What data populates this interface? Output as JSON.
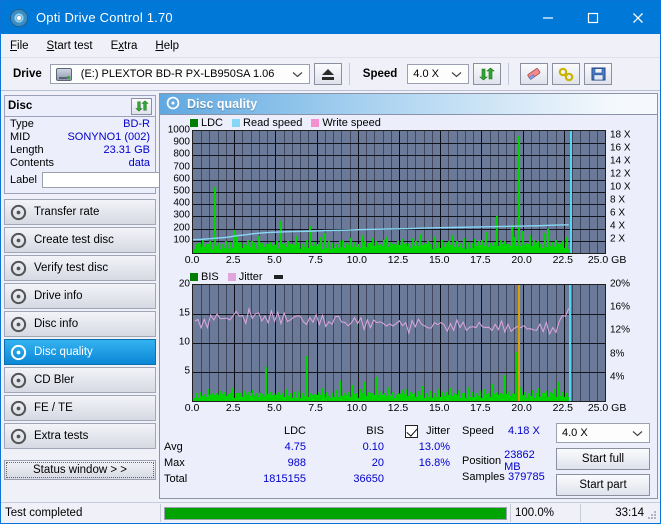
{
  "window": {
    "title": "Opti Drive Control 1.70",
    "app_icon": "disc-icon",
    "minimize": "minimize-icon",
    "maximize": "maximize-icon",
    "close": "close-icon"
  },
  "menu": [
    {
      "label": "File"
    },
    {
      "label": "Start test"
    },
    {
      "label": "Extra"
    },
    {
      "label": "Help"
    }
  ],
  "toolbar": {
    "drive_label": "Drive",
    "drive_value": "(E:)   PLEXTOR BD-R  PX-LB950SA 1.06",
    "eject_icon": "eject-icon",
    "speed_label": "Speed",
    "speed_value": "4.0 X",
    "refresh_icon": "refresh-icon",
    "erase_icon": "eraser-icon",
    "tools_icon": "tools-icon",
    "save_icon": "save-icon"
  },
  "disc_panel": {
    "title": "Disc",
    "refresh_icon": "refresh-icon",
    "rows": [
      {
        "label": "Type",
        "value": "BD-R"
      },
      {
        "label": "MID",
        "value": "SONYNO1 (002)"
      },
      {
        "label": "Length",
        "value": "23.31 GB"
      },
      {
        "label": "Contents",
        "value": "data"
      }
    ],
    "label_field_label": "Label",
    "label_field_value": "",
    "label_field_placeholder": "",
    "disc_button_icon": "disc-icon"
  },
  "nav": {
    "items": [
      {
        "label": "Transfer rate",
        "icon": "disc-icon",
        "active": false
      },
      {
        "label": "Create test disc",
        "icon": "disc-icon",
        "active": false
      },
      {
        "label": "Verify test disc",
        "icon": "disc-icon",
        "active": false
      },
      {
        "label": "Drive info",
        "icon": "disc-icon",
        "active": false
      },
      {
        "label": "Disc info",
        "icon": "disc-icon",
        "active": false
      },
      {
        "label": "Disc quality",
        "icon": "disc-icon",
        "active": true
      },
      {
        "label": "CD Bler",
        "icon": "disc-icon",
        "active": false
      },
      {
        "label": "FE / TE",
        "icon": "disc-icon",
        "active": false
      },
      {
        "label": "Extra tests",
        "icon": "disc-icon",
        "active": false
      }
    ],
    "status_window_label": "Status window > >"
  },
  "main": {
    "panel_title": "Disc quality",
    "panel_icon": "disc-icon"
  },
  "stats": {
    "col_headers": [
      "",
      "LDC",
      "BIS",
      "Jitter"
    ],
    "jitter_checkbox_checked": true,
    "jitter_label": "Jitter",
    "rows": [
      {
        "label": "Avg",
        "ldc": "4.75",
        "bis": "0.10",
        "jitter": "13.0%"
      },
      {
        "label": "Max",
        "ldc": "988",
        "bis": "20",
        "jitter": "16.8%"
      },
      {
        "label": "Total",
        "ldc": "1815155",
        "bis": "36650",
        "jitter": ""
      }
    ]
  },
  "readout": {
    "speed_label": "Speed",
    "speed_value": "4.18 X",
    "position_label": "Position",
    "position_value": "23862 MB",
    "samples_label": "Samples",
    "samples_value": "379785",
    "speed_select_value": "4.0 X",
    "start_full_label": "Start full",
    "start_part_label": "Start part"
  },
  "statusbar": {
    "message": "Test completed",
    "percent_label": "100.0%",
    "progress_percent": 100,
    "elapsed": "33:14"
  },
  "colors": {
    "accent": "#0078d7",
    "ldc": "#00d400",
    "bis": "#00d400",
    "read_speed": "#86d7f5",
    "write_speed": "#f48fd0",
    "jitter": "#dfa6dc",
    "plot_bg": "#6b7a99",
    "progress": "#00a300",
    "value_text": "#0000cc"
  },
  "chart_data": [
    {
      "type": "bar",
      "id": "ldc-chart",
      "title": "",
      "xlabel": "GB",
      "ylabel": "",
      "legend": [
        {
          "name": "LDC",
          "color": "#008000"
        },
        {
          "name": "Read speed",
          "color": "#86d7f5"
        },
        {
          "name": "Write speed",
          "color": "#f48fd0"
        }
      ],
      "legend_position": "top-left",
      "grid": true,
      "xlim": [
        0,
        25.0
      ],
      "xticks": [
        "0.0",
        "2.5",
        "5.0",
        "7.5",
        "10.0",
        "12.5",
        "15.0",
        "17.5",
        "20.0",
        "22.5",
        "25.0"
      ],
      "ylim": [
        0,
        1000
      ],
      "yticks": [
        100,
        200,
        300,
        400,
        500,
        600,
        700,
        800,
        900,
        1000
      ],
      "y2label": "X",
      "y2lim": [
        0,
        18.8
      ],
      "y2ticks": [
        "2 X",
        "4 X",
        "6 X",
        "8 X",
        "10 X",
        "12 X",
        "14 X",
        "16 X",
        "18 X"
      ],
      "series": [
        {
          "name": "LDC",
          "color": "#00d400",
          "baseline": 60,
          "x": [
            0.12,
            0.3,
            0.55,
            0.78,
            1.0,
            1.25,
            1.5,
            1.72,
            1.95,
            2.2,
            2.4,
            2.62,
            2.85,
            3.05,
            3.3,
            3.5,
            3.7,
            3.95,
            4.2,
            4.4,
            4.62,
            4.85,
            5.05,
            5.3,
            5.5,
            5.72,
            5.95,
            6.2,
            6.4,
            6.62,
            6.85,
            7.05,
            7.3,
            7.5,
            7.72,
            7.95,
            8.2,
            8.4,
            8.62,
            8.85,
            9.05,
            9.3,
            9.5,
            9.72,
            9.95,
            10.2,
            10.4,
            10.62,
            10.85,
            11.05,
            11.3,
            11.5,
            11.72,
            11.95,
            12.2,
            12.4,
            12.62,
            12.85,
            13.05,
            13.3,
            13.5,
            13.72,
            13.95,
            14.2,
            14.4,
            14.62,
            14.85,
            15.05,
            15.3,
            15.5,
            15.72,
            15.95,
            16.2,
            16.4,
            16.62,
            16.85,
            17.05,
            17.3,
            17.5,
            17.72,
            17.95,
            18.2,
            18.4,
            18.62,
            18.85,
            19.05,
            19.3,
            19.5,
            19.72,
            19.95,
            20.2,
            20.4,
            20.62,
            20.85,
            21.05,
            21.3,
            21.5,
            21.72,
            21.95,
            22.2,
            22.4,
            22.62,
            22.85
          ],
          "values": [
            70,
            80,
            110,
            75,
            95,
            545,
            85,
            70,
            100,
            90,
            185,
            150,
            90,
            75,
            110,
            95,
            80,
            140,
            85,
            70,
            90,
            75,
            100,
            260,
            80,
            95,
            70,
            140,
            85,
            75,
            110,
            220,
            90,
            70,
            130,
            160,
            100,
            85,
            70,
            95,
            110,
            80,
            125,
            90,
            75,
            145,
            100,
            85,
            120,
            95,
            70,
            110,
            130,
            90,
            75,
            100,
            115,
            85,
            70,
            120,
            95,
            155,
            80,
            100,
            75,
            130,
            90,
            110,
            85,
            95,
            145,
            100,
            80,
            125,
            90,
            70,
            115,
            95,
            105,
            170,
            85,
            90,
            300,
            110,
            95,
            75,
            230,
            130,
            960,
            180,
            85,
            150,
            110,
            95,
            75,
            160,
            200,
            90,
            110,
            75,
            100,
            135,
            90
          ]
        },
        {
          "name": "Read speed",
          "color": "#86d7f5",
          "type": "line",
          "x": [
            0.0,
            0.5,
            1.0,
            1.5,
            2.0,
            2.4,
            2.8,
            3.2,
            3.6,
            4.0,
            4.5,
            5.0,
            6.0,
            7.0,
            8.0,
            9.0,
            10.0,
            11.0,
            12.0,
            13.0,
            14.0,
            15.0,
            16.0,
            17.0,
            18.0,
            19.0,
            20.0,
            21.0,
            22.0,
            22.8
          ],
          "values_x": [
            2.05,
            2.1,
            2.2,
            2.3,
            2.4,
            2.55,
            2.7,
            2.8,
            2.95,
            3.05,
            3.15,
            3.2,
            3.3,
            3.35,
            3.45,
            3.5,
            3.6,
            3.65,
            3.7,
            3.75,
            3.85,
            3.9,
            3.95,
            4.0,
            4.05,
            4.1,
            4.15,
            4.2,
            4.3,
            4.35
          ]
        },
        {
          "name": "Write speed",
          "color": "#f48fd0",
          "values": []
        }
      ],
      "markers": [
        {
          "x": 22.85,
          "color": "#55d5f5",
          "label": "end-marker"
        }
      ]
    },
    {
      "type": "bar",
      "id": "bis-jitter-chart",
      "title": "",
      "xlabel": "GB",
      "legend": [
        {
          "name": "BIS",
          "color": "#008000"
        },
        {
          "name": "Jitter",
          "color": "#dfa6dc"
        }
      ],
      "legend_position": "top-left",
      "grid": true,
      "xlim": [
        0,
        25.0
      ],
      "xticks": [
        "0.0",
        "2.5",
        "5.0",
        "7.5",
        "10.0",
        "12.5",
        "15.0",
        "17.5",
        "20.0",
        "22.5",
        "25.0"
      ],
      "ylim": [
        0,
        20
      ],
      "yticks": [
        5,
        10,
        15,
        20
      ],
      "y2lim": [
        0,
        20
      ],
      "y2ticks": [
        "4%",
        "8%",
        "12%",
        "16%",
        "20%"
      ],
      "series": [
        {
          "name": "BIS",
          "color": "#00d400",
          "baseline": 1.0,
          "x": [
            0.1,
            0.35,
            0.6,
            0.85,
            1.1,
            1.35,
            1.6,
            1.85,
            2.1,
            2.35,
            2.6,
            2.85,
            3.1,
            3.35,
            3.6,
            3.85,
            4.1,
            4.35,
            4.6,
            4.85,
            5.1,
            5.35,
            5.6,
            5.85,
            6.1,
            6.35,
            6.6,
            6.85,
            7.1,
            7.35,
            7.6,
            7.85,
            8.1,
            8.35,
            8.6,
            8.85,
            9.1,
            9.35,
            9.6,
            9.85,
            10.1,
            10.35,
            10.6,
            10.85,
            11.1,
            11.35,
            11.6,
            11.85,
            12.1,
            12.35,
            12.6,
            12.85,
            13.1,
            13.35,
            13.6,
            13.85,
            14.1,
            14.35,
            14.6,
            14.85,
            15.1,
            15.35,
            15.6,
            15.85,
            16.1,
            16.35,
            16.6,
            16.85,
            17.1,
            17.35,
            17.6,
            17.85,
            18.1,
            18.35,
            18.6,
            18.85,
            19.1,
            19.35,
            19.6,
            19.85,
            20.1,
            20.35,
            20.6,
            20.85,
            21.1,
            21.35,
            21.6,
            21.85,
            22.1,
            22.35,
            22.6
          ],
          "values": [
            1.3,
            1.6,
            1.2,
            2.0,
            1.4,
            1.3,
            1.8,
            1.5,
            1.2,
            2.2,
            1.4,
            1.3,
            1.7,
            1.5,
            1.9,
            1.3,
            1.2,
            5.8,
            1.5,
            1.3,
            1.6,
            1.4,
            2.1,
            1.3,
            1.5,
            1.8,
            1.3,
            7.8,
            1.4,
            1.2,
            1.6,
            2.3,
            1.5,
            1.3,
            1.9,
            3.4,
            1.4,
            1.6,
            2.8,
            1.3,
            2.0,
            3.2,
            1.5,
            1.4,
            4.1,
            1.8,
            1.3,
            2.4,
            1.6,
            1.4,
            1.9,
            2.1,
            1.5,
            1.3,
            1.7,
            2.6,
            1.4,
            1.8,
            1.3,
            2.0,
            1.5,
            1.6,
            2.2,
            1.3,
            1.9,
            1.4,
            2.5,
            1.6,
            1.3,
            1.8,
            2.0,
            1.4,
            2.9,
            1.5,
            1.3,
            4.5,
            1.7,
            1.4,
            8.5,
            2.4,
            1.6,
            1.3,
            1.9,
            2.2,
            1.4,
            1.7,
            1.5,
            2.0,
            3.2,
            1.6,
            1.4
          ]
        },
        {
          "name": "Jitter",
          "color": "#dfa6dc",
          "type": "line",
          "x_start": 0.1,
          "x_end": 22.8,
          "values": [
            13.3,
            13.6,
            13.2,
            14.0,
            13.5,
            14.3,
            13.8,
            14.6,
            14.0,
            15.0,
            14.2,
            14.6,
            13.9,
            15.3,
            14.4,
            14.8,
            14.2,
            15.6,
            14.6,
            14.1,
            15.2,
            13.8,
            14.9,
            14.2,
            15.0,
            13.9,
            14.4,
            13.6,
            15.4,
            14.0,
            14.5,
            13.7,
            14.8,
            13.9,
            14.2,
            13.5,
            14.6,
            13.8,
            14.0,
            13.4,
            14.3,
            13.6,
            13.9,
            13.2,
            14.5,
            13.7,
            14.0,
            13.3,
            13.8,
            13.5,
            14.1,
            13.2,
            13.6,
            13.0,
            13.9,
            13.4,
            13.7,
            13.1,
            13.5,
            12.9,
            13.8,
            13.2,
            13.5,
            12.8,
            13.4,
            13.0,
            13.3,
            12.7,
            13.6,
            13.1,
            13.4,
            12.9,
            13.2,
            12.6,
            13.5,
            13.0,
            13.3,
            12.8,
            13.1,
            12.5,
            13.4,
            12.9,
            13.2,
            12.7,
            13.0,
            12.4,
            13.3,
            12.8,
            13.1,
            12.6,
            12.9,
            12.3,
            13.2,
            12.7,
            13.0,
            12.5,
            12.8,
            12.2,
            13.1,
            12.6,
            12.9,
            12.4,
            12.7,
            12.1,
            13.0,
            12.5,
            12.8,
            12.3,
            12.6,
            12.0,
            12.9,
            12.4,
            12.7,
            12.2,
            13.5,
            14.0,
            14.8,
            15.6
          ]
        }
      ],
      "markers": [
        {
          "x": 19.72,
          "color": "#d8a000",
          "label": "warn-marker"
        },
        {
          "x": 22.82,
          "color": "#55d5f5",
          "label": "end-marker"
        }
      ]
    }
  ]
}
